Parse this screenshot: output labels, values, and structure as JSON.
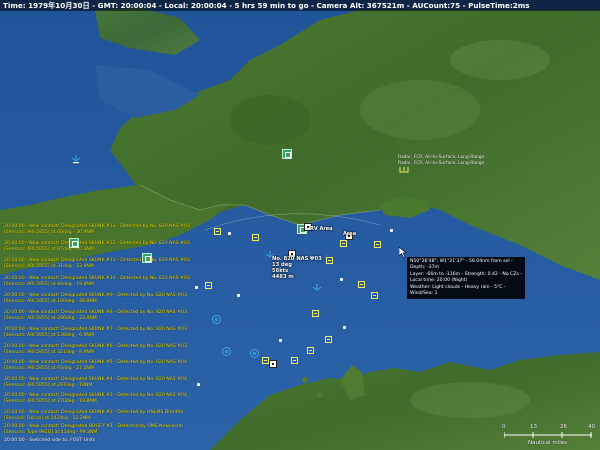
{
  "status_bar": {
    "text": "Time: 1979年10月30日 - GMT: 20:00:04 - Local: 20:00:04 - 5 hrs 59 min to go -  Camera Alt: 367521m - AUCount:75 - PulseTime:2ms"
  },
  "messages": [
    {
      "text": "20:00:00 - New contact! Designated SKUNK #13 - Detected by No. 820 NAS #03 [Sensors: ARI.5955] at 60deg - 30.9NM",
      "color": "yellow"
    },
    {
      "text": "20:00:00 - New contact! Designated SKUNK #12 - Detected by No. 820 NAS #03 [Sensors: ARI.5955] at 87deg - 20.3NM",
      "color": "yellow"
    },
    {
      "text": "20:00:00 - New contact! Designated SKUNK #11 - Detected by No. 820 NAS #03 [Sensors: ARI.5955] at 31deg - 23.9NM",
      "color": "yellow"
    },
    {
      "text": "20:00:00 - New contact! Designated SKUNK #10 - Detected by No. 820 NAS #03 [Sensors: ARI.5955] at 84deg - 19.8NM",
      "color": "yellow"
    },
    {
      "text": "20:00:00 - New contact! Designated SKUNK #9 - Detected by No. 820 NAS #03 [Sensors: ARI.5955] at 160deg - 28.8NM",
      "color": "yellow"
    },
    {
      "text": "20:00:00 - New contact! Designated SKUNK #8 - Detected by No. 820 NAS #03 [Sensors: ARI.5955] at 296deg - 23.8NM",
      "color": "yellow"
    },
    {
      "text": "20:00:00 - New contact! Designated SKUNK #7 - Detected by No. 820 NAS #03 [Sensors: ARI.5955] at 138deg - 6.9NM",
      "color": "yellow"
    },
    {
      "text": "20:00:00 - New contact! Designated SKUNK #6 - Detected by No. 820 NAS #03 [Sensors: ARI.5955] at 321deg - 8.9NM",
      "color": "yellow"
    },
    {
      "text": "20:00:00 - New contact! Designated SKUNK #5 - Detected by No. 820 NAS #04 [Sensors: ARI.5955] at 93deg - 27.2NM",
      "color": "yellow"
    },
    {
      "text": "20:00:00 - New contact! Designated SKUNK #4 - Detected by No. 820 NAS #04 [Sensors: ARI.5955] at 297deg - 18NM",
      "color": "yellow"
    },
    {
      "text": "20:00:00 - New contact! Designated SKUNK #3 - Detected by No. 820 NAS #04 [Sensors: ARI.5955] at 270deg - 19.8NM",
      "color": "yellow"
    },
    {
      "text": "20:00:00 - New contact! Designated SKUNK #2 - Detected by HNLMS Drenthe [Sensors: Decca] at 242deg - 12.2NM",
      "color": "yellow"
    },
    {
      "text": "20:00:00 - New contact! Designated BOGEY #1 - Detected by HMS Newcastle [Sensors: Type 992Q] at 41deg - 99.3NM",
      "color": "yellow"
    },
    {
      "text": "20:00:00 - Switched side to: FOST Units",
      "color": "white"
    }
  ],
  "tooltip": {
    "lines": [
      "N50°26'48\", W1°21'37\" - 56.04nm from sel - Depth: -37m",
      "Layer: -66m to -116m - Strength: 0.42 - No CZs -",
      "Local time: 20:00 (Night)",
      "Weather: Light clouds - Heavy rain - 5°C - Wind/Sea: 1"
    ]
  },
  "unit_label": {
    "lines": [
      "No. 820 NAS #03",
      "13 deg",
      "56kts",
      "4483 m"
    ]
  },
  "map_labels": {
    "rv_area": "RV Area",
    "rv_area_2": "Area"
  },
  "radar_label": {
    "lines": [
      "Radar, FCR, Air-to-Surface, Long-Range",
      "Radar, FCR, Air-to-Surface, Long-Range"
    ]
  },
  "scale_bar": {
    "ticks": [
      "0",
      "13",
      "26",
      "40"
    ],
    "unit": "Nautical miles"
  },
  "colors": {
    "sea": "#2a5a9c",
    "land": "#3e6a2a",
    "contact": "#f0f060",
    "friendly": "#3da5e8",
    "message": "#f0e000"
  }
}
